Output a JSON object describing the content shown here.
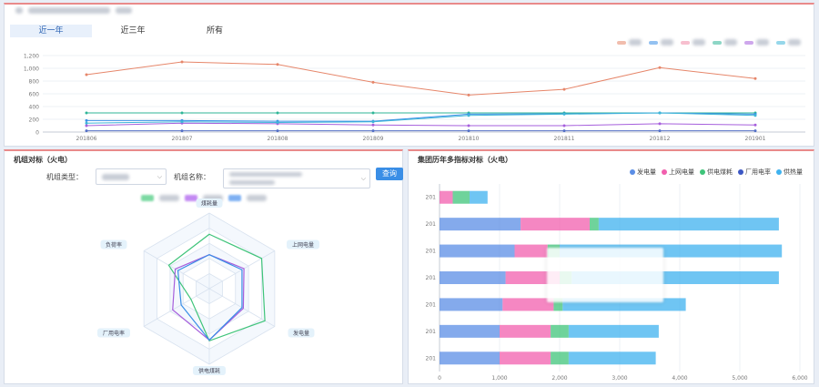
{
  "colors": {
    "series": [
      "#e6866a",
      "#2fb597",
      "#3a8ee6",
      "#a65fdc",
      "#3fb6d8",
      "#5470c6"
    ],
    "accent": "#3a8ee6"
  },
  "tabs": [
    {
      "label": "近一年"
    },
    {
      "label": "近三年"
    },
    {
      "label": "所有"
    }
  ],
  "line_chart": {
    "type": "line",
    "categories": [
      "201806",
      "201807",
      "201808",
      "201809",
      "201810",
      "201811",
      "201812",
      "201901"
    ],
    "yticks": [
      "0",
      "200",
      "400",
      "600",
      "800",
      "1,000",
      "1,200"
    ],
    "ylim": [
      0,
      1200
    ],
    "series": [
      {
        "values": [
          900,
          1100,
          1060,
          780,
          580,
          670,
          1010,
          840
        ]
      },
      {
        "values": [
          300,
          300,
          300,
          300,
          300,
          300,
          300,
          300
        ]
      },
      {
        "values": [
          180,
          180,
          170,
          170,
          280,
          285,
          300,
          280
        ]
      },
      {
        "values": [
          100,
          140,
          130,
          110,
          100,
          100,
          130,
          110
        ]
      },
      {
        "values": [
          140,
          160,
          150,
          160,
          260,
          280,
          300,
          260
        ]
      },
      {
        "values": [
          20,
          20,
          20,
          20,
          20,
          20,
          20,
          20
        ]
      }
    ]
  },
  "unit_panel": {
    "title": "机组对标（火电）",
    "type_label": "机组类型：",
    "name_label": "机组名称：",
    "query_label": "查询"
  },
  "radar": {
    "type": "radar",
    "indicators": [
      "煤耗量",
      "上网电量",
      "发电量",
      "供电煤耗",
      "厂用电率",
      "负荷率"
    ],
    "series": [
      {
        "values": [
          0.72,
          0.8,
          0.85,
          0.69,
          0.28,
          0.62
        ]
      },
      {
        "values": [
          0.45,
          0.53,
          0.52,
          0.68,
          0.56,
          0.52
        ]
      },
      {
        "values": [
          0.45,
          0.5,
          0.5,
          0.68,
          0.43,
          0.48
        ]
      }
    ]
  },
  "group_panel": {
    "title": "集团历年多指标对标（火电）",
    "legend": [
      "发电量",
      "上网电量",
      "供电煤耗",
      "厂用电率",
      "供热量"
    ],
    "legend_colors": [
      "#5b8ee6",
      "#f15fae",
      "#3fc47a",
      "#3c57c4",
      "#3fb2ef"
    ]
  },
  "stacked_bar": {
    "type": "bar",
    "categories": [
      "201",
      "201",
      "201",
      "201",
      "201",
      "201",
      "201"
    ],
    "xticks": [
      "0",
      "1,000",
      "2,000",
      "3,000",
      "4,000",
      "5,000",
      "6,000"
    ],
    "xlim": [
      0,
      6000
    ],
    "series": [
      {
        "name": "发电量",
        "values": [
          0,
          1350,
          1250,
          1100,
          1050,
          1000,
          1000
        ]
      },
      {
        "name": "上网电量",
        "values": [
          220,
          1150,
          550,
          900,
          850,
          850,
          850
        ]
      },
      {
        "name": "供电煤耗",
        "values": [
          280,
          150,
          200,
          200,
          150,
          300,
          300
        ]
      },
      {
        "name": "厂用电率",
        "values": [
          0,
          0,
          0,
          0,
          0,
          0,
          0
        ]
      },
      {
        "name": "供热量",
        "values": [
          300,
          3000,
          3700,
          3450,
          2050,
          1500,
          1450
        ]
      }
    ]
  }
}
